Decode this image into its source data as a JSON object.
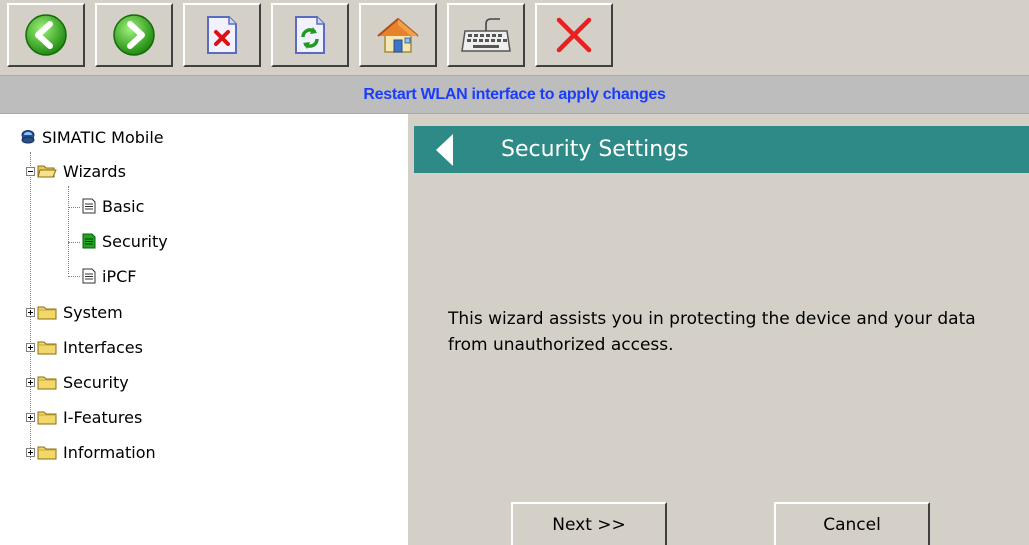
{
  "toolbar": {
    "buttons": [
      {
        "icon": "back-arrow-icon"
      },
      {
        "icon": "forward-arrow-icon"
      },
      {
        "icon": "discard-page-icon"
      },
      {
        "icon": "refresh-icon"
      },
      {
        "icon": "home-icon"
      },
      {
        "icon": "keyboard-icon"
      },
      {
        "icon": "close-icon"
      }
    ]
  },
  "notice": {
    "text": "Restart WLAN interface to apply changes",
    "color": "#1a3cff"
  },
  "tree": {
    "root": "SIMATIC Mobile",
    "items": [
      {
        "label": "Wizards",
        "expanded": true
      },
      {
        "label": "Basic"
      },
      {
        "label": "Security",
        "selected": true
      },
      {
        "label": "iPCF"
      },
      {
        "label": "System",
        "expanded": false
      },
      {
        "label": "Interfaces",
        "expanded": false
      },
      {
        "label": "Security",
        "expanded": false
      },
      {
        "label": "I-Features",
        "expanded": false
      },
      {
        "label": "Information",
        "expanded": false
      }
    ]
  },
  "content": {
    "title": "Security Settings",
    "header_color": "#2d8a86",
    "description": "This wizard assists you in protecting the device and your data from unauthorized access.",
    "next_label": "Next >>",
    "cancel_label": "Cancel"
  }
}
